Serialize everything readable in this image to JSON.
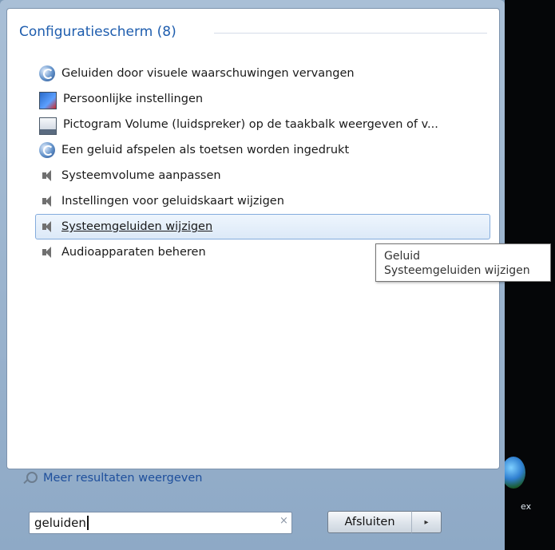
{
  "category": {
    "title": "Configuratiescherm (8)"
  },
  "results": [
    {
      "label": "Geluiden door visuele waarschuwingen vervangen",
      "icon": "ease-of-access-icon"
    },
    {
      "label": "Persoonlijke instellingen",
      "icon": "personalization-icon"
    },
    {
      "label": "Pictogram Volume (luidspreker) op de taakbalk weergeven of v...",
      "icon": "taskbar-icon"
    },
    {
      "label": "Een geluid afspelen als toetsen worden ingedrukt",
      "icon": "ease-of-access-icon"
    },
    {
      "label": "Systeemvolume aanpassen",
      "icon": "speaker-icon"
    },
    {
      "label": "Instellingen voor geluidskaart wijzigen",
      "icon": "speaker-icon"
    },
    {
      "label": "Systeemgeluiden wijzigen",
      "icon": "speaker-icon",
      "selected": true
    },
    {
      "label": "Audioapparaten beheren",
      "icon": "speaker-icon"
    }
  ],
  "tooltip": {
    "line1": "Geluid",
    "line2": "Systeemgeluiden wijzigen"
  },
  "more_results": {
    "label": "Meer resultaten weergeven"
  },
  "search": {
    "value": "geluiden",
    "clear": "×"
  },
  "shutdown": {
    "label": "Afsluiten",
    "arrow": "▸"
  },
  "desktop": {
    "icon_label": "ex"
  }
}
